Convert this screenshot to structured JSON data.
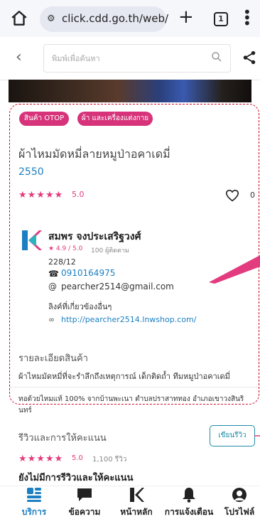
{
  "browser": {
    "url": "click.cdd.go.th/web/",
    "tab_count": "1"
  },
  "search": {
    "placeholder": "พิมพ์เพื่อค้นหา"
  },
  "product": {
    "tags": [
      "สินค้า OTOP",
      "ผ้า และเครื่องแต่งกาย"
    ],
    "title": "ผ้าไหมมัดหมี่ลายหมูป่าอคาเดมี่",
    "year": "2550",
    "stars": "★★★★★",
    "rating": "5.0",
    "likes": "0"
  },
  "seller": {
    "name": "สมพร จงประเสริฐวงศ์",
    "rating": "★ 4.9 / 5.0",
    "followers": "100 ผู้ติดตาม",
    "address": "228/12",
    "phone": "0910164975",
    "email": "pearcher2514@gmail.com",
    "links_heading": "ลิงค์ที่เกี่ยวข้องอื่นๆ",
    "shop_link": "http://pearcher2514.lnwshop.com/"
  },
  "details": {
    "heading": "รายละเอียดสินค้า",
    "line1": "ผ้าไหมมัดหมี่ที่จะรำลึกถึงเหตุการณ์ เด็กติดถ้ำ ทีมหมูป่าอคาเดมี่",
    "line2": "ทอด้วยไหมแท้ 100% จากบ้านพะเนา ตำบลปราสาททอง อำเภอเขาวงสินรินทร์"
  },
  "reviews": {
    "heading": "รีวิวและการให้คะแนน",
    "write_button": "เขียนรีวิว",
    "stars": "★★★★★",
    "score": "5.0",
    "count": "1,100 รีวิว",
    "empty_text": "ยังไม่มีการรีวิวและให้คะแนน"
  },
  "nav": {
    "services": "บริการ",
    "messages": "ข้อความ",
    "home": "หน้าหลัก",
    "notifications": "การแจ้งเตือน",
    "profile": "โปรไฟล์"
  },
  "colors": {
    "accent_pink": "#e23b7e",
    "link_blue": "#1c7fc1",
    "highlight_red": "#c8102e"
  }
}
